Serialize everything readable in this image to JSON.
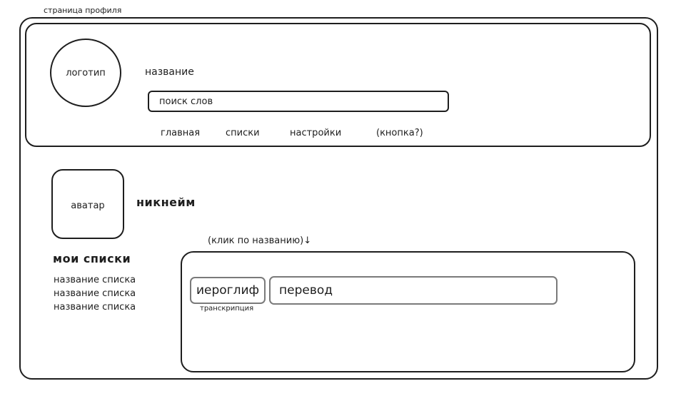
{
  "page": {
    "title": "страница профиля"
  },
  "header": {
    "logo_label": "логотип",
    "app_name": "название",
    "search": {
      "value": "поиск слов"
    },
    "nav": [
      {
        "label": "главная"
      },
      {
        "label": "списки"
      },
      {
        "label": "настройки"
      },
      {
        "label": "(кнопка?)"
      }
    ]
  },
  "profile": {
    "avatar_label": "аватар",
    "nickname": "никнейм"
  },
  "lists": {
    "heading": "мои списки",
    "items": [
      {
        "label": "название списка"
      },
      {
        "label": "название списка"
      },
      {
        "label": "название списка"
      }
    ]
  },
  "word_panel": {
    "hint": "(клик по названию)↓",
    "hieroglyph": "иероглиф",
    "translation": "перевод",
    "transcription": "транскрипция"
  },
  "colors": {
    "stroke": "#1e1e1e",
    "secondary_stroke": "#7a7a7a",
    "background": "#ffffff"
  }
}
